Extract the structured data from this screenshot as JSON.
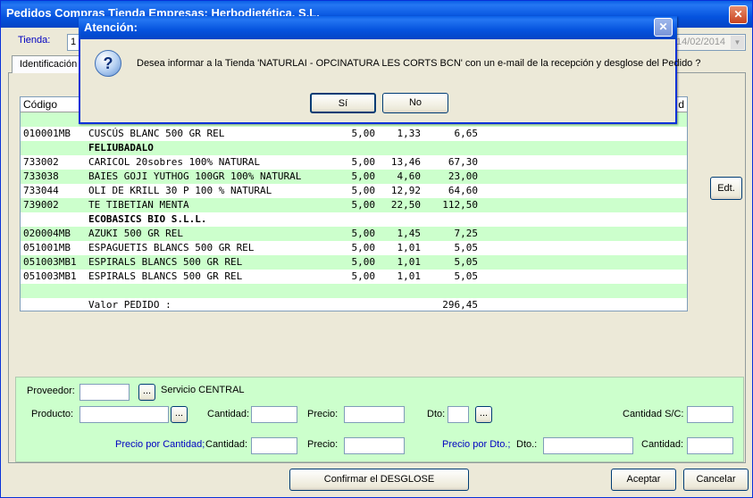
{
  "window": {
    "title": "Pedidos Compras Tienda Empresas: Herbodietética, S.L.",
    "tienda_label": "Tienda:",
    "tienda_value": "1",
    "date_value": "14/02/2014"
  },
  "tab": {
    "label": "Identificación"
  },
  "grid": {
    "header_code": "Código",
    "header_right": "d",
    "rows": [
      {
        "style": "g",
        "code": "",
        "desc": "",
        "qty": "",
        "price": "",
        "total": ""
      },
      {
        "style": "w",
        "code": "010001MB",
        "desc": "CUSCÚS BLANC 500 GR REL",
        "qty": "5,00",
        "price": "1,33",
        "total": "6,65"
      },
      {
        "style": "g grp",
        "code": "",
        "desc": "FELIUBADALO",
        "qty": "",
        "price": "",
        "total": ""
      },
      {
        "style": "w",
        "code": "733002",
        "desc": "CARICOL 20sobres 100% NATURAL",
        "qty": "5,00",
        "price": "13,46",
        "total": "67,30"
      },
      {
        "style": "g",
        "code": "733038",
        "desc": "BAIES GOJI YUTHOG 100GR 100% NATURAL",
        "qty": "5,00",
        "price": "4,60",
        "total": "23,00"
      },
      {
        "style": "w",
        "code": "733044",
        "desc": "OLI DE KRILL 30 P 100 % NATURAL",
        "qty": "5,00",
        "price": "12,92",
        "total": "64,60"
      },
      {
        "style": "g",
        "code": "739002",
        "desc": "TE TIBETIAN MENTA",
        "qty": "5,00",
        "price": "22,50",
        "total": "112,50"
      },
      {
        "style": "w grp",
        "code": "",
        "desc": "ECOBASICS BIO S.L.L.",
        "qty": "",
        "price": "",
        "total": ""
      },
      {
        "style": "g",
        "code": "020004MB",
        "desc": "AZUKI 500 GR REL",
        "qty": "5,00",
        "price": "1,45",
        "total": "7,25"
      },
      {
        "style": "w",
        "code": "051001MB",
        "desc": "ESPAGUETIS BLANCS 500 GR REL",
        "qty": "5,00",
        "price": "1,01",
        "total": "5,05"
      },
      {
        "style": "g",
        "code": "051003MB1",
        "desc": "ESPIRALS BLANCS 500 GR REL",
        "qty": "5,00",
        "price": "1,01",
        "total": "5,05"
      },
      {
        "style": "w",
        "code": "051003MB1",
        "desc": "ESPIRALS BLANCS 500 GR REL",
        "qty": "5,00",
        "price": "1,01",
        "total": "5,05"
      },
      {
        "style": "g",
        "code": "",
        "desc": "",
        "qty": "",
        "price": "",
        "total": ""
      },
      {
        "style": "w",
        "code": "",
        "desc": "Valor PEDIDO :",
        "qty": "",
        "price": "",
        "total": "296,45"
      }
    ]
  },
  "edit_button": "Edt.",
  "panel": {
    "proveedor": "Proveedor:",
    "servicio": "Servicio CENTRAL",
    "producto": "Producto:",
    "cantidad": "Cantidad:",
    "precio": "Precio:",
    "dto": "Dto:",
    "cantidad_sc": "Cantidad S/C:",
    "precio_por_cantidad": "Precio por Cantidad;",
    "precio_por_dto": "Precio por Dto.;",
    "dto2": "Dto.:",
    "ellipsis": "..."
  },
  "buttons": {
    "confirmar": "Confirmar el DESGLOSE",
    "aceptar": "Aceptar",
    "cancelar": "Cancelar"
  },
  "dialog": {
    "title": "Atención:",
    "message": "Desea informar a la Tienda 'NATURLAI - OPCINATURA LES CORTS BCN' con un e-mail de la recepción y desglose del Pedido ?",
    "yes": "Sí",
    "no": "No",
    "icon": "question-icon"
  }
}
